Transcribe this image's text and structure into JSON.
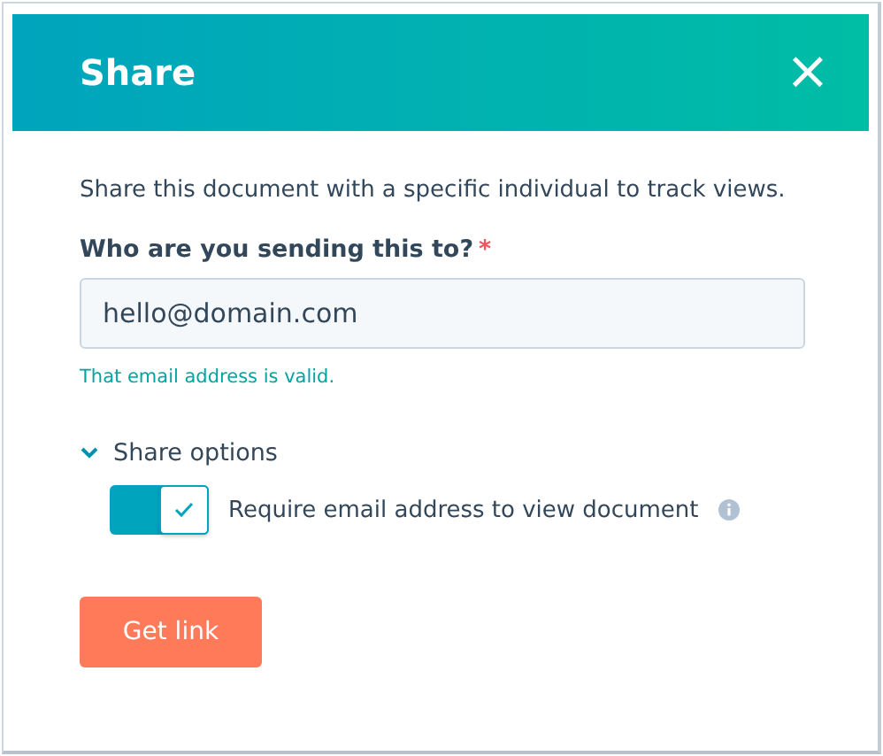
{
  "dialog": {
    "title": "Share",
    "close_symbol": "×"
  },
  "description": "Share this document with a specific individual to track views.",
  "email_field": {
    "label": "Who are you sending this to?",
    "required": true,
    "required_mark": "*",
    "value": "hello@domain.com",
    "validation": "That email address is valid."
  },
  "share_options": {
    "label": "Share options",
    "expanded": true,
    "toggle": {
      "label": "Require email address to view document",
      "on": true
    }
  },
  "button": "Get link"
}
